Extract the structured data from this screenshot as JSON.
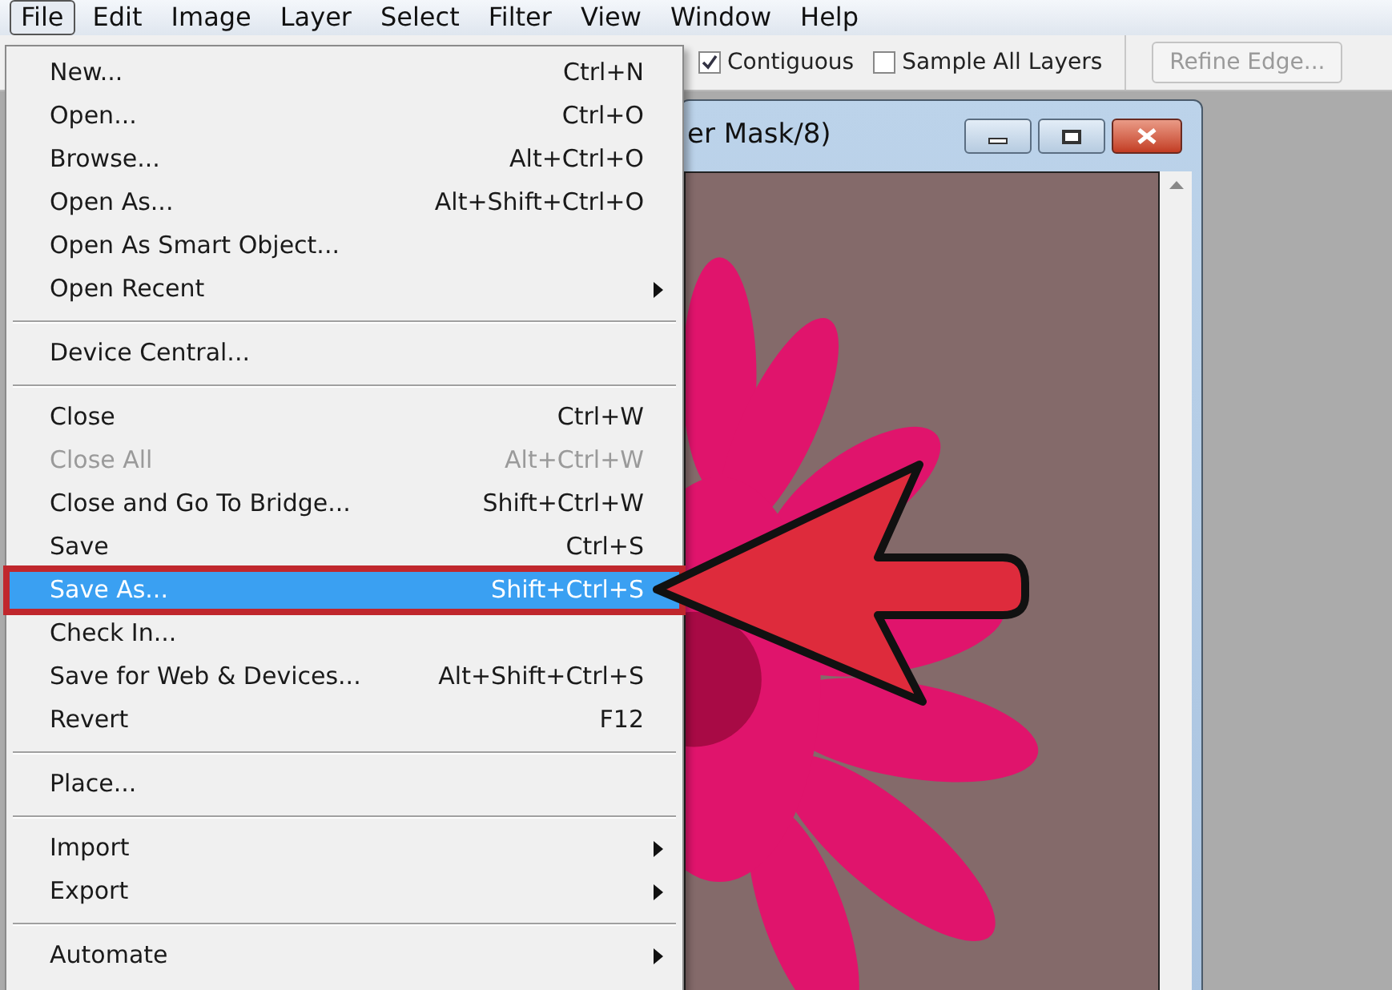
{
  "menubar": [
    {
      "label": "File",
      "selected": true
    },
    {
      "label": "Edit",
      "selected": false
    },
    {
      "label": "Image",
      "selected": false
    },
    {
      "label": "Layer",
      "selected": false
    },
    {
      "label": "Select",
      "selected": false
    },
    {
      "label": "Filter",
      "selected": false
    },
    {
      "label": "View",
      "selected": false
    },
    {
      "label": "Window",
      "selected": false
    },
    {
      "label": "Help",
      "selected": false
    }
  ],
  "toolbar": {
    "options": [
      {
        "label": "Contiguous",
        "checked": true
      },
      {
        "label": "Sample All Layers",
        "checked": false
      }
    ],
    "button": {
      "label": "Refine Edge...",
      "disabled": true
    }
  },
  "document": {
    "title": "er Mask/8)"
  },
  "file_menu": [
    {
      "kind": "item",
      "label": "New...",
      "shortcut": "Ctrl+N",
      "disabled": false,
      "selected": false,
      "submenu": false
    },
    {
      "kind": "item",
      "label": "Open...",
      "shortcut": "Ctrl+O",
      "disabled": false,
      "selected": false,
      "submenu": false
    },
    {
      "kind": "item",
      "label": "Browse...",
      "shortcut": "Alt+Ctrl+O",
      "disabled": false,
      "selected": false,
      "submenu": false
    },
    {
      "kind": "item",
      "label": "Open As...",
      "shortcut": "Alt+Shift+Ctrl+O",
      "disabled": false,
      "selected": false,
      "submenu": false
    },
    {
      "kind": "item",
      "label": "Open As Smart Object...",
      "disabled": false,
      "selected": false,
      "submenu": false
    },
    {
      "kind": "item",
      "label": "Open Recent",
      "disabled": false,
      "selected": false,
      "submenu": true
    },
    {
      "kind": "separator"
    },
    {
      "kind": "item",
      "label": "Device Central...",
      "disabled": false,
      "selected": false,
      "submenu": false
    },
    {
      "kind": "separator"
    },
    {
      "kind": "item",
      "label": "Close",
      "shortcut": "Ctrl+W",
      "disabled": false,
      "selected": false,
      "submenu": false
    },
    {
      "kind": "item",
      "label": "Close All",
      "shortcut": "Alt+Ctrl+W",
      "disabled": true,
      "selected": false,
      "submenu": false
    },
    {
      "kind": "item",
      "label": "Close and Go To Bridge...",
      "shortcut": "Shift+Ctrl+W",
      "disabled": false,
      "selected": false,
      "submenu": false
    },
    {
      "kind": "item",
      "label": "Save",
      "shortcut": "Ctrl+S",
      "disabled": false,
      "selected": false,
      "submenu": false
    },
    {
      "kind": "item",
      "label": "Save As...",
      "shortcut": "Shift+Ctrl+S",
      "disabled": false,
      "selected": true,
      "submenu": false
    },
    {
      "kind": "item",
      "label": "Check In...",
      "disabled": false,
      "selected": false,
      "submenu": false
    },
    {
      "kind": "item",
      "label": "Save for Web & Devices...",
      "shortcut": "Alt+Shift+Ctrl+S",
      "disabled": false,
      "selected": false,
      "submenu": false
    },
    {
      "kind": "item",
      "label": "Revert",
      "shortcut": "F12",
      "disabled": false,
      "selected": false,
      "submenu": false
    },
    {
      "kind": "separator"
    },
    {
      "kind": "item",
      "label": "Place...",
      "disabled": false,
      "selected": false,
      "submenu": false
    },
    {
      "kind": "separator"
    },
    {
      "kind": "item",
      "label": "Import",
      "disabled": false,
      "selected": false,
      "submenu": true
    },
    {
      "kind": "item",
      "label": "Export",
      "disabled": false,
      "selected": false,
      "submenu": true
    },
    {
      "kind": "separator"
    },
    {
      "kind": "item",
      "label": "Automate",
      "disabled": false,
      "selected": false,
      "submenu": true
    }
  ]
}
